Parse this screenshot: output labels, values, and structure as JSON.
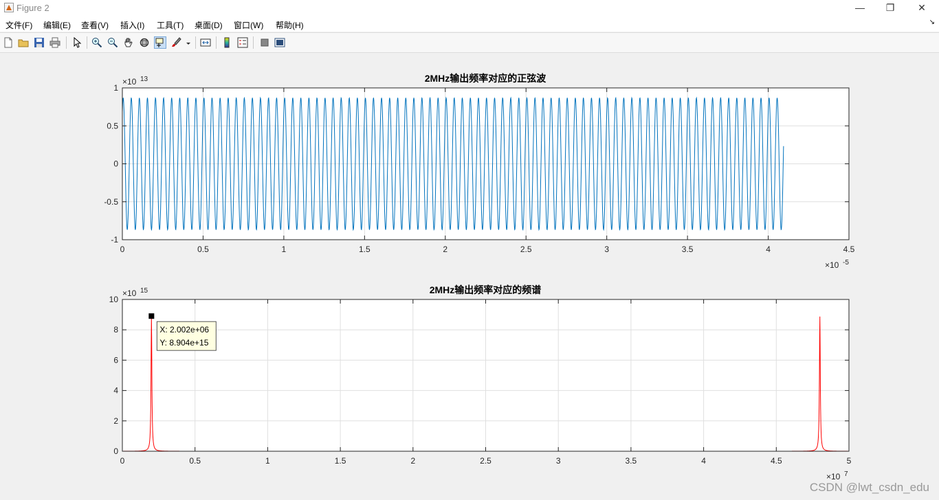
{
  "window": {
    "title": "Figure 2",
    "minimize": "—",
    "restore": "❐",
    "close": "✕"
  },
  "menu": [
    "文件(F)",
    "编辑(E)",
    "查看(V)",
    "插入(I)",
    "工具(T)",
    "桌面(D)",
    "窗口(W)",
    "帮助(H)"
  ],
  "toolbar_icons": [
    "new-figure-icon",
    "open-file-icon",
    "save-icon",
    "print-icon",
    "select-arrow-icon",
    "zoom-in-icon",
    "zoom-out-icon",
    "pan-hand-icon",
    "rotate-3d-icon",
    "data-cursor-icon",
    "brush-icon",
    "link-plot-icon",
    "colorbar-icon",
    "legend-icon",
    "hide-plot-tools-icon",
    "show-plot-tools-icon"
  ],
  "chart_data": [
    {
      "type": "line",
      "title": "2MHz输出频率对应的正弦波",
      "xlim": [
        0,
        4.5
      ],
      "ylim": [
        -1,
        1
      ],
      "xticks": [
        "0",
        "0.5",
        "1",
        "1.5",
        "2",
        "2.5",
        "3",
        "3.5",
        "4",
        "4.5"
      ],
      "yticks": [
        "-1",
        "-0.5",
        "0",
        "0.5",
        "1"
      ],
      "x_exponent": "-5",
      "y_exponent": "13",
      "grid": true,
      "series": [
        {
          "frequency_cycles_per_unit": 20,
          "amplitude": 0.87,
          "x_range": [
            0,
            4.095
          ],
          "color": "#0072bd"
        }
      ]
    },
    {
      "type": "line",
      "title": "2MHz输出频率对应的频谱",
      "xlim": [
        0,
        5
      ],
      "ylim": [
        0,
        10
      ],
      "xticks": [
        "0",
        "0.5",
        "1",
        "1.5",
        "2",
        "2.5",
        "3",
        "3.5",
        "4",
        "4.5",
        "5"
      ],
      "yticks": [
        "0",
        "2",
        "4",
        "6",
        "8",
        "10"
      ],
      "x_exponent": "7",
      "y_exponent": "15",
      "grid": true,
      "series": [
        {
          "peaks": [
            {
              "x": 0.2002,
              "y": 8.904
            },
            {
              "x": 4.7998,
              "y": 8.904
            }
          ],
          "color": "#ff0000"
        }
      ],
      "datatip": {
        "x": 0.2002,
        "y": 8.904,
        "x_text": "X: 2.002e+06",
        "y_text": "Y: 8.904e+15"
      }
    }
  ],
  "watermark": "CSDN @lwt_csdn_edu"
}
